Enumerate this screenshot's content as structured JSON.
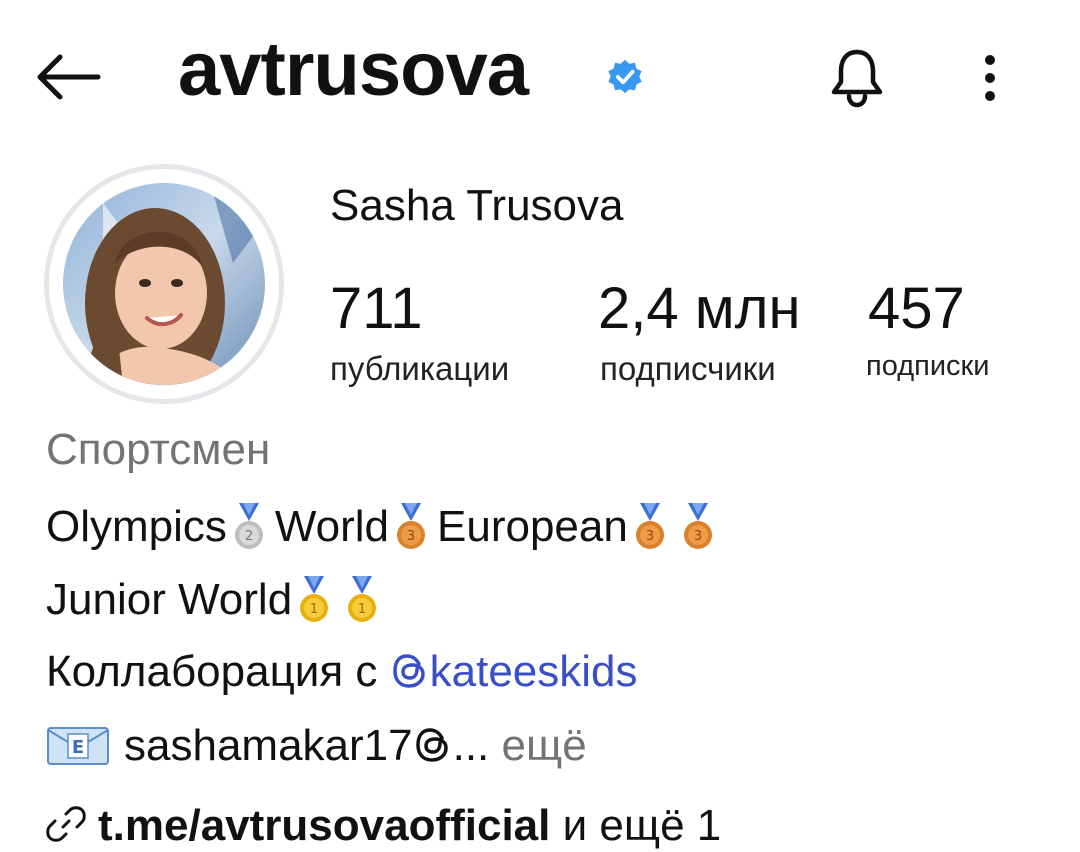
{
  "header": {
    "username": "avtrusova",
    "back_icon": "arrow-left-icon",
    "verified_icon": "verified-badge-icon",
    "bell_icon": "bell-icon",
    "more_icon": "more-vertical-icon",
    "verified_color": "#3897f0"
  },
  "profile": {
    "display_name": "Sasha Trusova",
    "stats": [
      {
        "value": "711",
        "label": "публикации"
      },
      {
        "value": "2,4 млн",
        "label": "подписчики"
      },
      {
        "value": "457",
        "label": "подписки"
      }
    ]
  },
  "bio": {
    "category": "Спортсмен",
    "line1": {
      "olympics": "Olympics",
      "world": "World",
      "european": "European"
    },
    "line2": {
      "junior_world": "Junior World"
    },
    "line3": {
      "prefix": "Коллаборация с ",
      "mention": "kateeskids"
    },
    "line4": {
      "email": "sashamakar17",
      "ellipsis": "...",
      "more": "ещё"
    },
    "mention_color": "#3a4fc7"
  },
  "link": {
    "url": "t.me/avtrusovaofficial",
    "suffix": " и ещё 1"
  }
}
